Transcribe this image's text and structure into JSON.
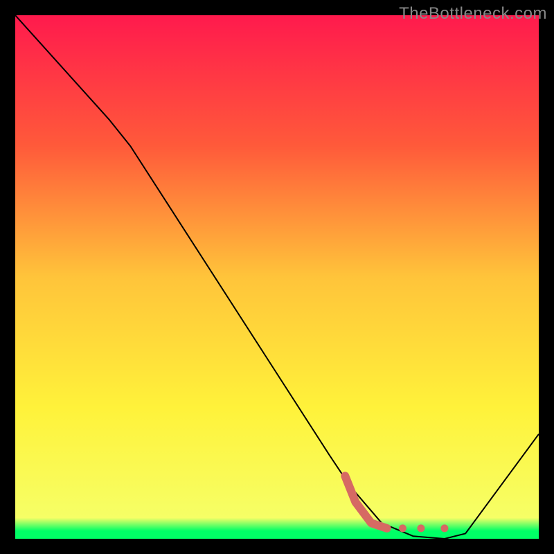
{
  "watermark": "TheBottleneck.com",
  "chart_data": {
    "type": "line",
    "title": "",
    "xlabel": "",
    "ylabel": "",
    "xlim": [
      0,
      100
    ],
    "ylim": [
      0,
      100
    ],
    "background_gradient": [
      {
        "offset": 0,
        "color": "#ff1a4d"
      },
      {
        "offset": 0.25,
        "color": "#ff5a3a"
      },
      {
        "offset": 0.5,
        "color": "#ffc43a"
      },
      {
        "offset": 0.75,
        "color": "#fff23a"
      },
      {
        "offset": 0.96,
        "color": "#f6ff66"
      },
      {
        "offset": 0.985,
        "color": "#00ff66"
      },
      {
        "offset": 1.0,
        "color": "#00ff66"
      }
    ],
    "series": [
      {
        "name": "bottleneck-curve",
        "type": "line",
        "color": "#000000",
        "stroke_width": 2,
        "points": [
          {
            "x": 0,
            "y": 100
          },
          {
            "x": 18,
            "y": 80
          },
          {
            "x": 22,
            "y": 75
          },
          {
            "x": 60,
            "y": 16
          },
          {
            "x": 64,
            "y": 10
          },
          {
            "x": 70,
            "y": 3
          },
          {
            "x": 76,
            "y": 0.5
          },
          {
            "x": 82,
            "y": 0
          },
          {
            "x": 86,
            "y": 1
          },
          {
            "x": 100,
            "y": 20
          }
        ]
      },
      {
        "name": "highlight-region",
        "type": "line",
        "color": "#d66a63",
        "stroke_width": 12,
        "linecap": "round",
        "points": [
          {
            "x": 63,
            "y": 12
          },
          {
            "x": 65,
            "y": 7
          },
          {
            "x": 68,
            "y": 3
          },
          {
            "x": 71,
            "y": 2
          }
        ]
      },
      {
        "name": "highlight-dots",
        "type": "scatter",
        "color": "#d66a63",
        "radius": 5.5,
        "points": [
          {
            "x": 74,
            "y": 2
          },
          {
            "x": 77.5,
            "y": 2
          },
          {
            "x": 82,
            "y": 2
          }
        ]
      }
    ]
  }
}
